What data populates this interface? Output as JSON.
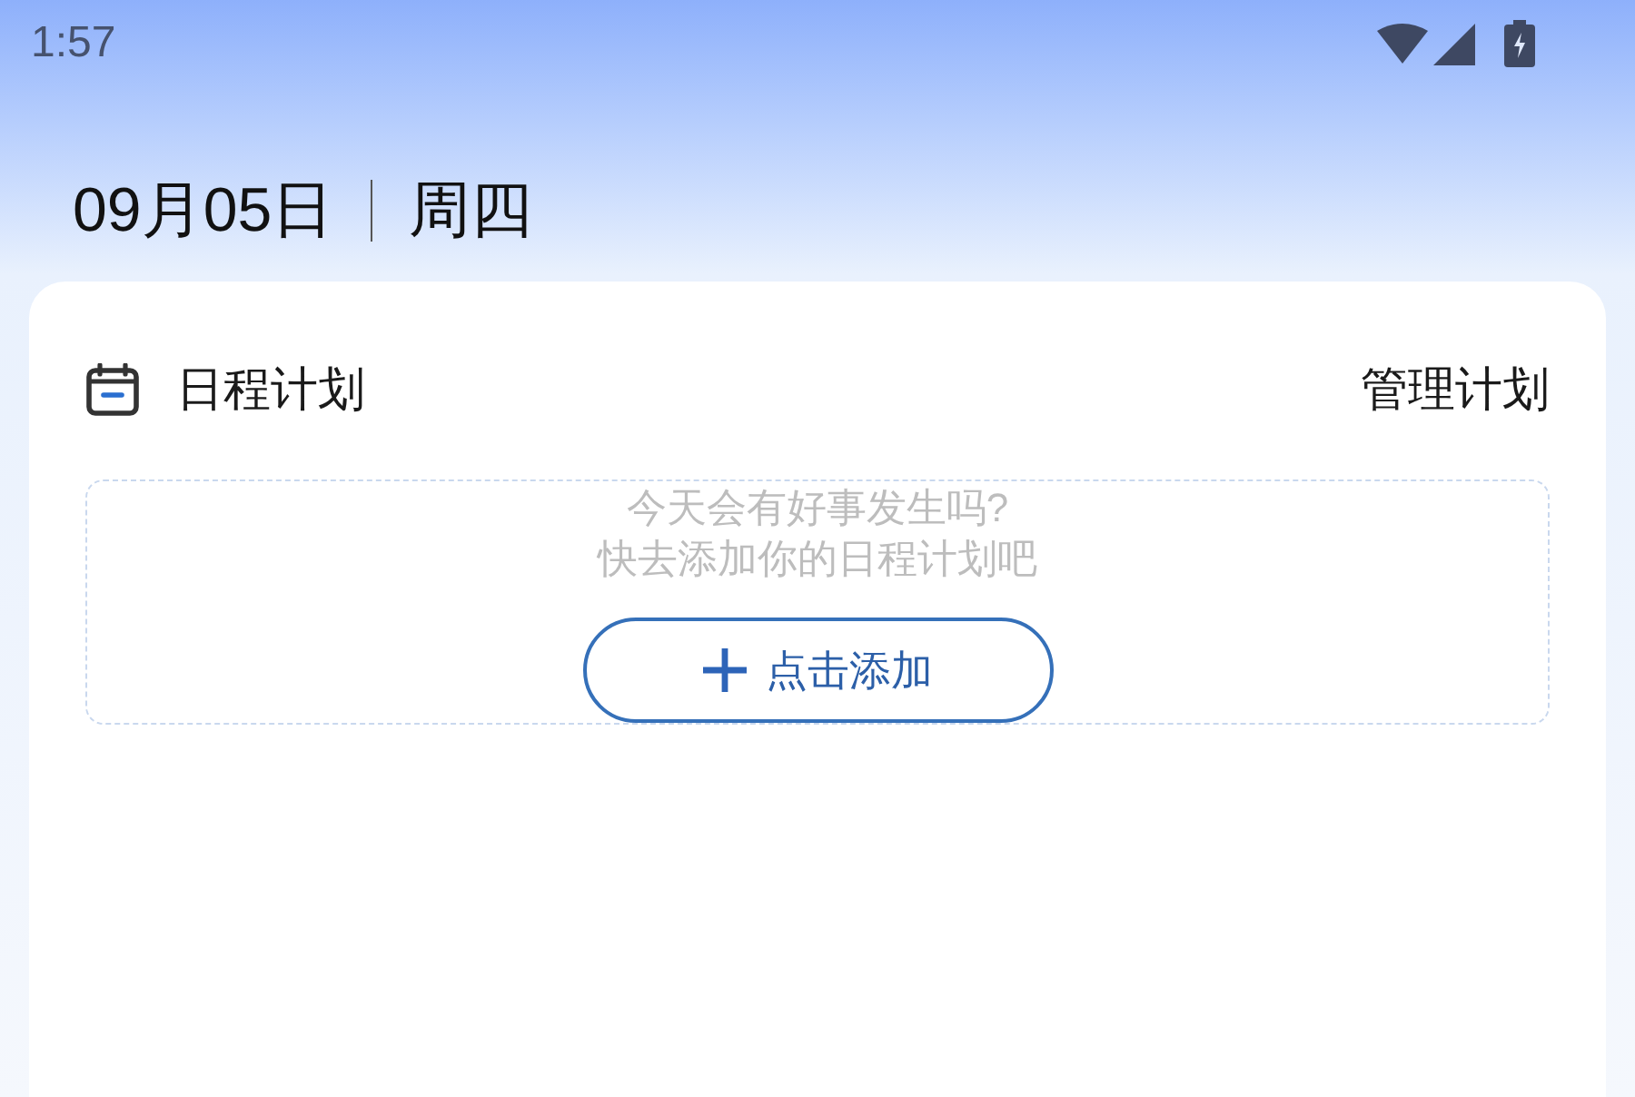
{
  "status_bar": {
    "time": "1:57"
  },
  "header": {
    "date": "09月05日",
    "weekday": "周四"
  },
  "schedule_card": {
    "title": "日程计划",
    "manage_link": "管理计划",
    "empty_state": {
      "lines": [
        "今天会有好事发生吗?",
        "快去添加你的日程计划吧"
      ],
      "add_button": "点击添加"
    }
  }
}
